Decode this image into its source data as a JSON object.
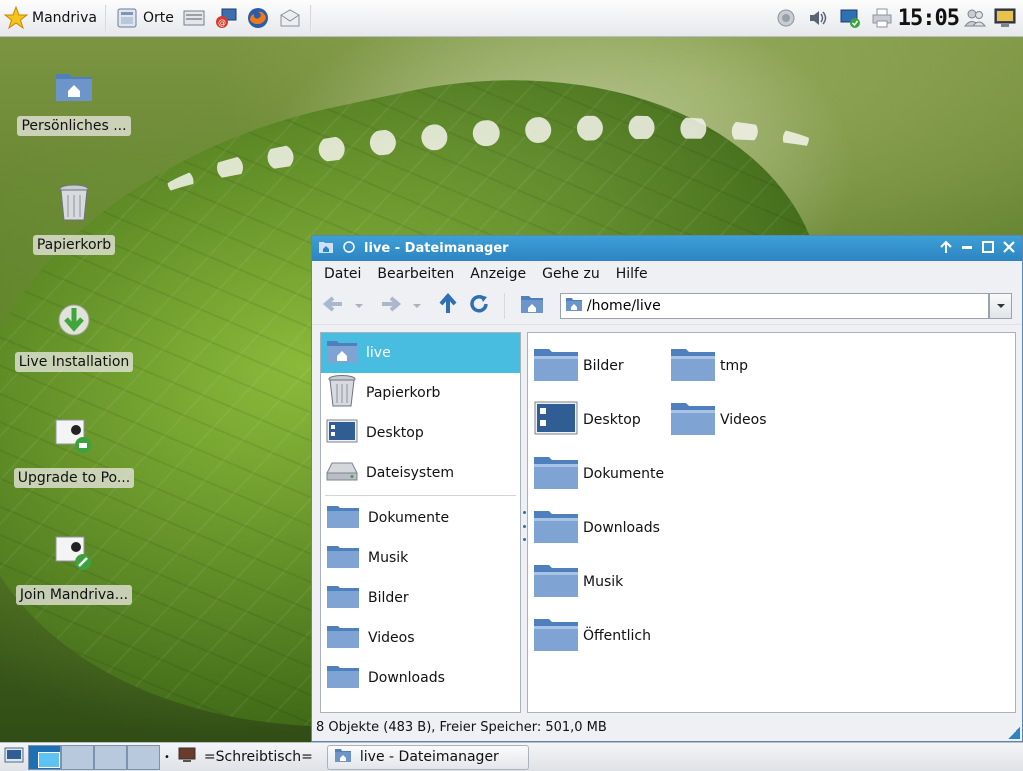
{
  "top_panel": {
    "menu_label": "Mandriva",
    "places_label": "Orte",
    "clock": "15:05"
  },
  "desktop_icons": [
    {
      "label": "Persönliches ..."
    },
    {
      "label": "Papierkorb"
    },
    {
      "label": "Live Installation"
    },
    {
      "label": "Upgrade to Po..."
    },
    {
      "label": "Join Mandriva..."
    }
  ],
  "window": {
    "title": "live - Dateimanager",
    "menu": [
      "Datei",
      "Bearbeiten",
      "Anzeige",
      "Gehe zu",
      "Hilfe"
    ],
    "address": "/home/live",
    "sidebar": [
      {
        "label": "live",
        "icon": "home-folder-icon"
      },
      {
        "label": "Papierkorb",
        "icon": "trash-icon"
      },
      {
        "label": "Desktop",
        "icon": "desktop-icon"
      },
      {
        "label": "Dateisystem",
        "icon": "drive-icon"
      },
      {
        "label": "Dokumente",
        "icon": "folder-icon"
      },
      {
        "label": "Musik",
        "icon": "folder-icon"
      },
      {
        "label": "Bilder",
        "icon": "folder-icon"
      },
      {
        "label": "Videos",
        "icon": "folder-icon"
      },
      {
        "label": "Downloads",
        "icon": "folder-icon"
      }
    ],
    "files": [
      {
        "label": "Bilder"
      },
      {
        "label": "Desktop"
      },
      {
        "label": "Dokumente"
      },
      {
        "label": "Downloads"
      },
      {
        "label": "Musik"
      },
      {
        "label": "Öffentlich"
      },
      {
        "label": "tmp"
      },
      {
        "label": "Videos"
      }
    ],
    "status": "8 Objekte (483 B), Freier Speicher: 501,0 MB"
  },
  "bottom_panel": {
    "desktop_name": "=Schreibtisch=",
    "task_label": "live - Dateimanager"
  },
  "colors": {
    "titlebar": "#2c84c2",
    "selection": "#49bde0",
    "folder": "#6d95c9"
  }
}
